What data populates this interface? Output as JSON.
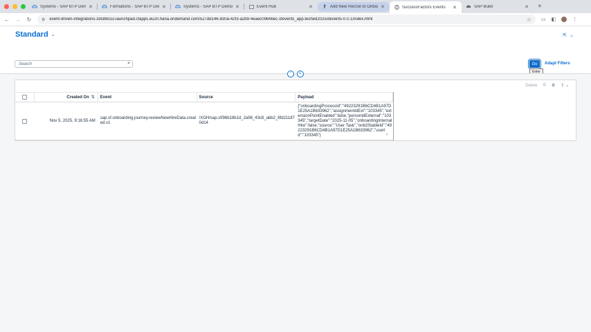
{
  "tabs": [
    {
      "title": "Systems - SAP BTP Demo - S",
      "icon": "sap-cloud-icon"
    },
    {
      "title": "Formations - SAP BTP Demo",
      "icon": "sap-cloud-icon"
    },
    {
      "title": "Systems - SAP BTP Demo - S",
      "icon": "sap-cloud-icon"
    },
    {
      "title": "Event Hub",
      "icon": "page-icon"
    },
    {
      "title": "Add New Recruit to Onboarding",
      "icon": "sap-f-icon"
    },
    {
      "title": "SuccessFactors Events",
      "icon": "globe-icon",
      "active": true
    },
    {
      "title": "SAP Build",
      "icon": "sap-cloud-icon"
    }
  ],
  "address_bar": {
    "url": "event-driven-integrations-zds89o1o.launchpad.cfapps.eu20.hana.ondemand.com/527dd146-830a-42f3-a2b9-4eaec09b4bec.sfevents_app.teched2025sfevents-0.0.1/index.html"
  },
  "header": {
    "variant_title": "Standard"
  },
  "filter_bar": {
    "search_placeholder": "Search",
    "go_label": "Go",
    "go_tooltip": "Enter",
    "adapt_filters_label": "Adapt Filters"
  },
  "table": {
    "toolbar": {
      "delete_label": "Delete"
    },
    "columns": [
      "Created On",
      "Event",
      "Source",
      "Payload"
    ],
    "rows": [
      {
        "created_on": "Nov 5, 2025, 9:16:55 AM",
        "event": "sap.sf.onboarding.journey.reviewNewHireData.created.v1",
        "source": "/XGH/sap.sf/96b18b1d_2a98_43c8_abb2_8fd211870d14",
        "payload": "{\"onboardingProcessId\":\"49223291B6CD4B1A97D1E25A1B633962\",\"assignmentIdExt\":\"103345\",\"extensionPointEnabled\":false,\"personIdExternal\":\"103345\",\"targetDate\":\"2025-11-05\",\"onboardingInternalHire\":false,\"source\":\"User Task\",\"onb2StableId\":\"49223291B6CD4B1A97D1E25A1B633962\",\"userId\":\"103345\"}"
      }
    ]
  },
  "colors": {
    "accent": "#0a6ed1",
    "tab_strip": "#dee1e6"
  }
}
